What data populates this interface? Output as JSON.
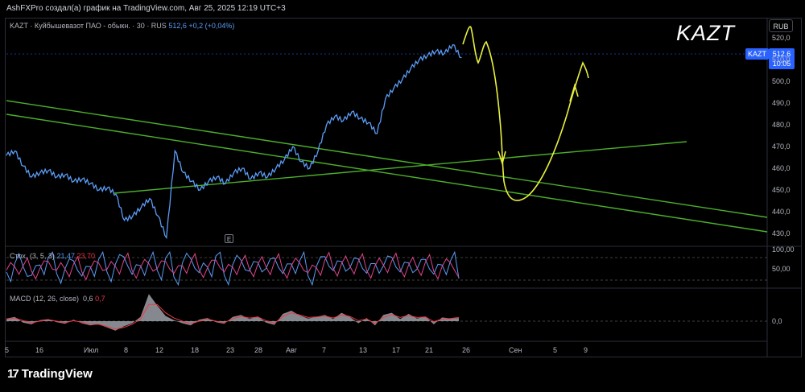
{
  "header": {
    "credit": "AshFXPro создал(а) график на TradingView.com, Авг 25, 2025 12:19 UTC+3"
  },
  "main_legend": {
    "symbol_line": "KAZT · Куйбышевазот ПАО - обыкн. · 30 · RUS",
    "price": "512,6",
    "change": "+0,2 (+0,04%)"
  },
  "annotation_ticker": "KAZT",
  "currency_badge": "RUB",
  "last_price_tag": {
    "symbol": "KAZT",
    "price": "512,6",
    "countdown": "10:05"
  },
  "earnings_marker": "E",
  "stoch_legend": {
    "label": "Стох. (3, 5, 3)",
    "k": "21,47",
    "d": "23,70"
  },
  "macd_legend": {
    "label": "MACD (12, 26, close)",
    "macd": "0,6",
    "signal": "0,7"
  },
  "price_axis": [
    "520,0",
    "510,0",
    "500,0",
    "490,0",
    "480,0",
    "470,0",
    "460,0",
    "450,0",
    "440,0",
    "430,0"
  ],
  "stoch_axis": [
    "100,00",
    "50,00"
  ],
  "macd_axis": [
    "0,0"
  ],
  "time_axis": [
    "5",
    "16",
    "Июл",
    "8",
    "12",
    "18",
    "23",
    "28",
    "Авг",
    "7",
    "13",
    "17",
    "21",
    "26",
    "Сен",
    "5",
    "9"
  ],
  "footer": {
    "brand": "TradingView"
  },
  "colors": {
    "price_line": "#5b9cf6",
    "trendline": "#4caf2a",
    "drawing": "#e8f03c",
    "stoch_k": "#5b9cf6",
    "stoch_d": "#e0448b",
    "macd_hist": "#b2b5be",
    "macd_signal": "#f23645",
    "accent": "#2962ff"
  },
  "chart_data": [
    {
      "type": "line",
      "title": "KAZT · Куйбышевазот ПАО - обыкн. · 30 · RUS",
      "xlabel": "",
      "ylabel": "",
      "x_ticks": [
        "5",
        "16",
        "Июл",
        "8",
        "12",
        "18",
        "23",
        "28",
        "Авг",
        "7",
        "13",
        "17",
        "21",
        "26",
        "Сен",
        "5",
        "9"
      ],
      "ylim": [
        426,
        524
      ],
      "series": [
        {
          "name": "KAZT",
          "values": [
            468,
            470,
            463,
            458,
            460,
            461,
            458,
            459,
            456,
            457,
            455,
            452,
            453,
            450,
            438,
            440,
            444,
            448,
            440,
            430,
            470,
            460,
            456,
            452,
            456,
            458,
            455,
            460,
            462,
            457,
            460,
            458,
            462,
            466,
            472,
            465,
            462,
            470,
            482,
            486,
            484,
            488,
            485,
            483,
            478,
            494,
            499,
            503,
            508,
            512,
            514,
            516,
            515,
            519,
            513
          ]
        }
      ]
    },
    {
      "type": "line",
      "title": "Стох. (3, 5, 3)",
      "ylim": [
        0,
        100
      ],
      "series": [
        {
          "name": "%K",
          "values": [
            40,
            65,
            55,
            30,
            60,
            82,
            35,
            50,
            72,
            28,
            55,
            76,
            40,
            62,
            84,
            33,
            58,
            70,
            45,
            80,
            25,
            66,
            78,
            38,
            54,
            86,
            30,
            60,
            74,
            42,
            68,
            50,
            80,
            35,
            63,
            72,
            28,
            56,
            84,
            44,
            70,
            52,
            78,
            36,
            64,
            58,
            82,
            40,
            66,
            48,
            76,
            34,
            60,
            72,
            21
          ]
        },
        {
          "name": "%D",
          "values": [
            45,
            55,
            58,
            42,
            50,
            70,
            45,
            48,
            62,
            40,
            50,
            66,
            48,
            56,
            72,
            44,
            54,
            64,
            50,
            70,
            36,
            58,
            70,
            46,
            52,
            74,
            40,
            54,
            66,
            48,
            62,
            54,
            70,
            44,
            58,
            66,
            38,
            52,
            74,
            50,
            64,
            56,
            70,
            44,
            58,
            60,
            72,
            48,
            60,
            52,
            68,
            42,
            56,
            66,
            24
          ]
        }
      ]
    },
    {
      "type": "area",
      "title": "MACD (12, 26, close)",
      "series": [
        {
          "name": "MACD",
          "values": [
            0.5,
            0.8,
            -0.3,
            -0.6,
            0.2,
            0.4,
            -0.2,
            -0.5,
            0.3,
            -0.4,
            -0.8,
            -0.6,
            -1.2,
            -1.8,
            -1.0,
            -0.4,
            0.8,
            5.2,
            3.0,
            1.0,
            0.2,
            -0.4,
            -0.8,
            0.3,
            0.6,
            -0.2,
            -0.5,
            0.8,
            1.2,
            0.4,
            0.9,
            -0.3,
            -0.7,
            1.4,
            2.0,
            1.1,
            0.5,
            0.8,
            1.2,
            0.4,
            1.6,
            0.8,
            -0.4,
            0.6,
            -0.8,
            1.2,
            1.6,
            0.4,
            1.4,
            0.5,
            0.9,
            -0.6,
            0.7,
            0.5,
            0.6
          ]
        },
        {
          "name": "Signal",
          "values": [
            0.4,
            0.6,
            0.1,
            -0.3,
            0.0,
            0.3,
            0.0,
            -0.3,
            0.1,
            -0.2,
            -0.6,
            -0.6,
            -1.0,
            -1.5,
            -1.2,
            -0.6,
            0.4,
            3.2,
            3.2,
            1.6,
            0.6,
            0.0,
            -0.5,
            0.0,
            0.4,
            0.0,
            -0.3,
            0.5,
            0.9,
            0.6,
            0.8,
            0.1,
            -0.4,
            0.9,
            1.6,
            1.2,
            0.7,
            0.8,
            1.0,
            0.6,
            1.2,
            0.9,
            0.1,
            0.4,
            -0.4,
            0.7,
            1.3,
            0.7,
            1.1,
            0.7,
            0.8,
            -0.1,
            0.4,
            0.5,
            0.7
          ]
        }
      ]
    }
  ]
}
